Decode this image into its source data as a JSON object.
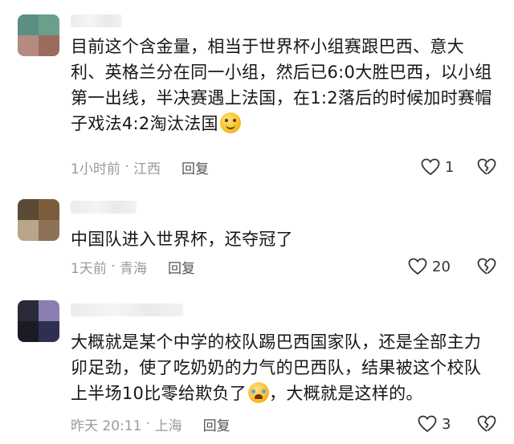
{
  "comments": [
    {
      "text": "目前这个含金量，相当于世界杯小组赛跟巴西、意大利、英格兰分在同一小组，然后已6:0大胜巴西，以小组第一出线，半决赛遇上法国，在1:2落后的时候加时赛帽子戏法4:2淘汰法国",
      "emoji": "smile",
      "time": "1小时前",
      "location": "江西",
      "reply": "回复",
      "likes": "1",
      "avatar_colors": [
        "#5b8f83",
        "#6a9f8c",
        "#b48b80",
        "#9b6b5c"
      ]
    },
    {
      "text": "中国队进入世界杯，还夺冠了",
      "emoji": "",
      "time": "1天前",
      "location": "青海",
      "reply": "回复",
      "likes": "20",
      "avatar_colors": [
        "#5a4a36",
        "#7a5e3c",
        "#b9a58a",
        "#8c7256"
      ]
    },
    {
      "text": "大概就是某个中学的校队踢巴西国家队，还是全部主力卯足劲，使了吃奶奶的力气的巴西队，结果被这个校队上半场10比零给欺负了",
      "text_after": "，大概就是这样的。",
      "emoji": "cry",
      "time": "昨天 20:11",
      "location": "上海",
      "reply": "回复",
      "likes": "3",
      "avatar_colors": [
        "#2a2a3a",
        "#8a7fb0",
        "#1b1b24",
        "#2d3050"
      ]
    }
  ]
}
